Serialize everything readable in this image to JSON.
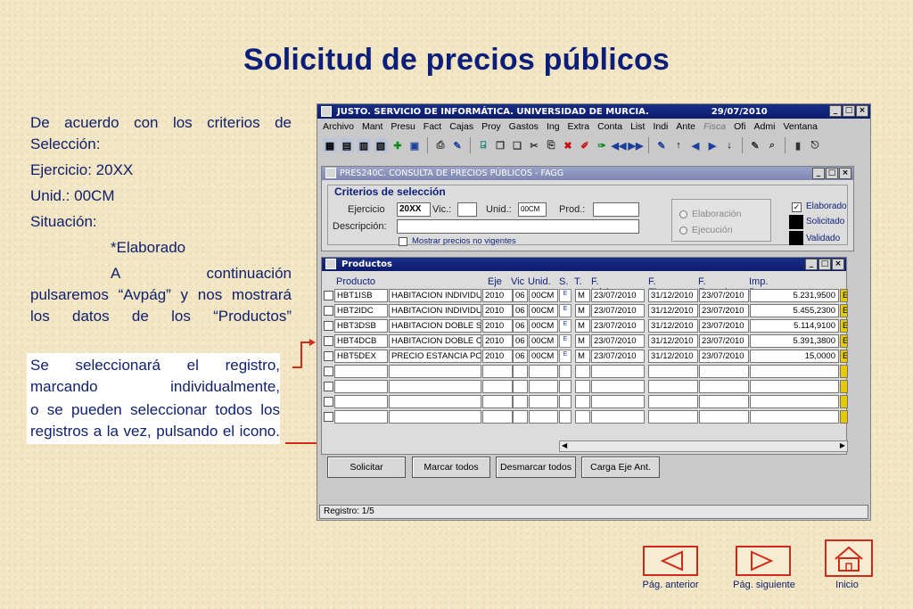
{
  "title": "Solicitud de precios públicos",
  "left_text": {
    "p1": "De acuerdo con los criterios de Selección:",
    "p2": "Ejercicio: 20XX",
    "p3": "Unid.: 00CM",
    "p4": "Situación:",
    "p5": "*Elaborado",
    "p6": "A continuación pulsaremos “Avpág” y nos mostrará los datos de los “Productos”"
  },
  "note_text": {
    "p1": "Se seleccionará el registro, marcando individualmente,",
    "p2": "o se pueden seleccionar todos los registros a la vez, pulsando el icono."
  },
  "window": {
    "title": "JUSTO. SERVICIO DE INFORMÁTICA. UNIVERSIDAD DE MURCIA.",
    "date": "29/07/2010",
    "min": "_",
    "max": "□",
    "close": "×",
    "menu": [
      "Archivo",
      "Mant",
      "Presu",
      "Fact",
      "Cajas",
      "Proy",
      "Gastos",
      "Ing",
      "Extra",
      "Conta",
      "List",
      "Indi",
      "Ante",
      "Fisca",
      "Ofi",
      "Admi",
      "Ventana"
    ]
  },
  "form": {
    "title": "PRES240C. CONSULTA DE PRECIOS PÚBLICOS - FAGG",
    "section": "Criterios de selección",
    "ejercicio_label": "Ejercicio",
    "ejercicio_value": "20XX",
    "vic_label": "Vic.:",
    "unid_label": "Unid.:",
    "unid_value": "00CM",
    "prod_label": "Prod.:",
    "descripcion_label": "Descripción:",
    "mostrar_label": "Mostrar precios no vigentes",
    "radio1": "Elaboración",
    "radio2": "Ejecución",
    "chk_elaborado": "Elaborado",
    "chk_solicitado": "Solicitado",
    "chk_validado": "Validado"
  },
  "products": {
    "title": "Productos",
    "headers": [
      "Producto",
      "Eje",
      "Vic",
      "Unid.",
      "S.",
      "T.",
      "F. Inicio",
      "F. Fin",
      "F. Entrada",
      "Imp. Base"
    ],
    "rows": [
      [
        "HBT1ISB",
        "HABITACION INDIVIDU",
        "2010",
        "06",
        "00CM",
        "E",
        "M",
        "23/07/2010",
        "31/12/2010",
        "23/07/2010",
        "5.231,9500",
        "E"
      ],
      [
        "HBT2IDC",
        "HABITACION INDIVIDU",
        "2010",
        "06",
        "00CM",
        "E",
        "M",
        "23/07/2010",
        "31/12/2010",
        "23/07/2010",
        "5.455,2300",
        "E"
      ],
      [
        "HBT3DSB",
        "HABITACION DOBLE S",
        "2010",
        "06",
        "00CM",
        "E",
        "M",
        "23/07/2010",
        "31/12/2010",
        "23/07/2010",
        "5.114,9100",
        "E"
      ],
      [
        "HBT4DCB",
        "HABITACION DOBLE C",
        "2010",
        "06",
        "00CM",
        "E",
        "M",
        "23/07/2010",
        "31/12/2010",
        "23/07/2010",
        "5.391,3800",
        "E"
      ],
      [
        "HBT5DEX",
        "PRECIO ESTANCIA PO",
        "2010",
        "06",
        "00CM",
        "E",
        "M",
        "23/07/2010",
        "31/12/2010",
        "23/07/2010",
        "15,0000",
        "E"
      ]
    ],
    "empty_rows": 4
  },
  "buttons": {
    "solicitar": "Solicitar",
    "marcar": "Marcar todos",
    "desmarcar": "Desmarcar todos",
    "carga": "Carga Eje Ant."
  },
  "status": "Registro: 1/5",
  "nav": {
    "prev": "Pág. anterior",
    "next": "Pág. siguiente",
    "home": "Inicio"
  },
  "colors": {
    "title": "#0b1f7a",
    "accent": "#d12a1b",
    "titlebar": "#0c1c6c"
  }
}
